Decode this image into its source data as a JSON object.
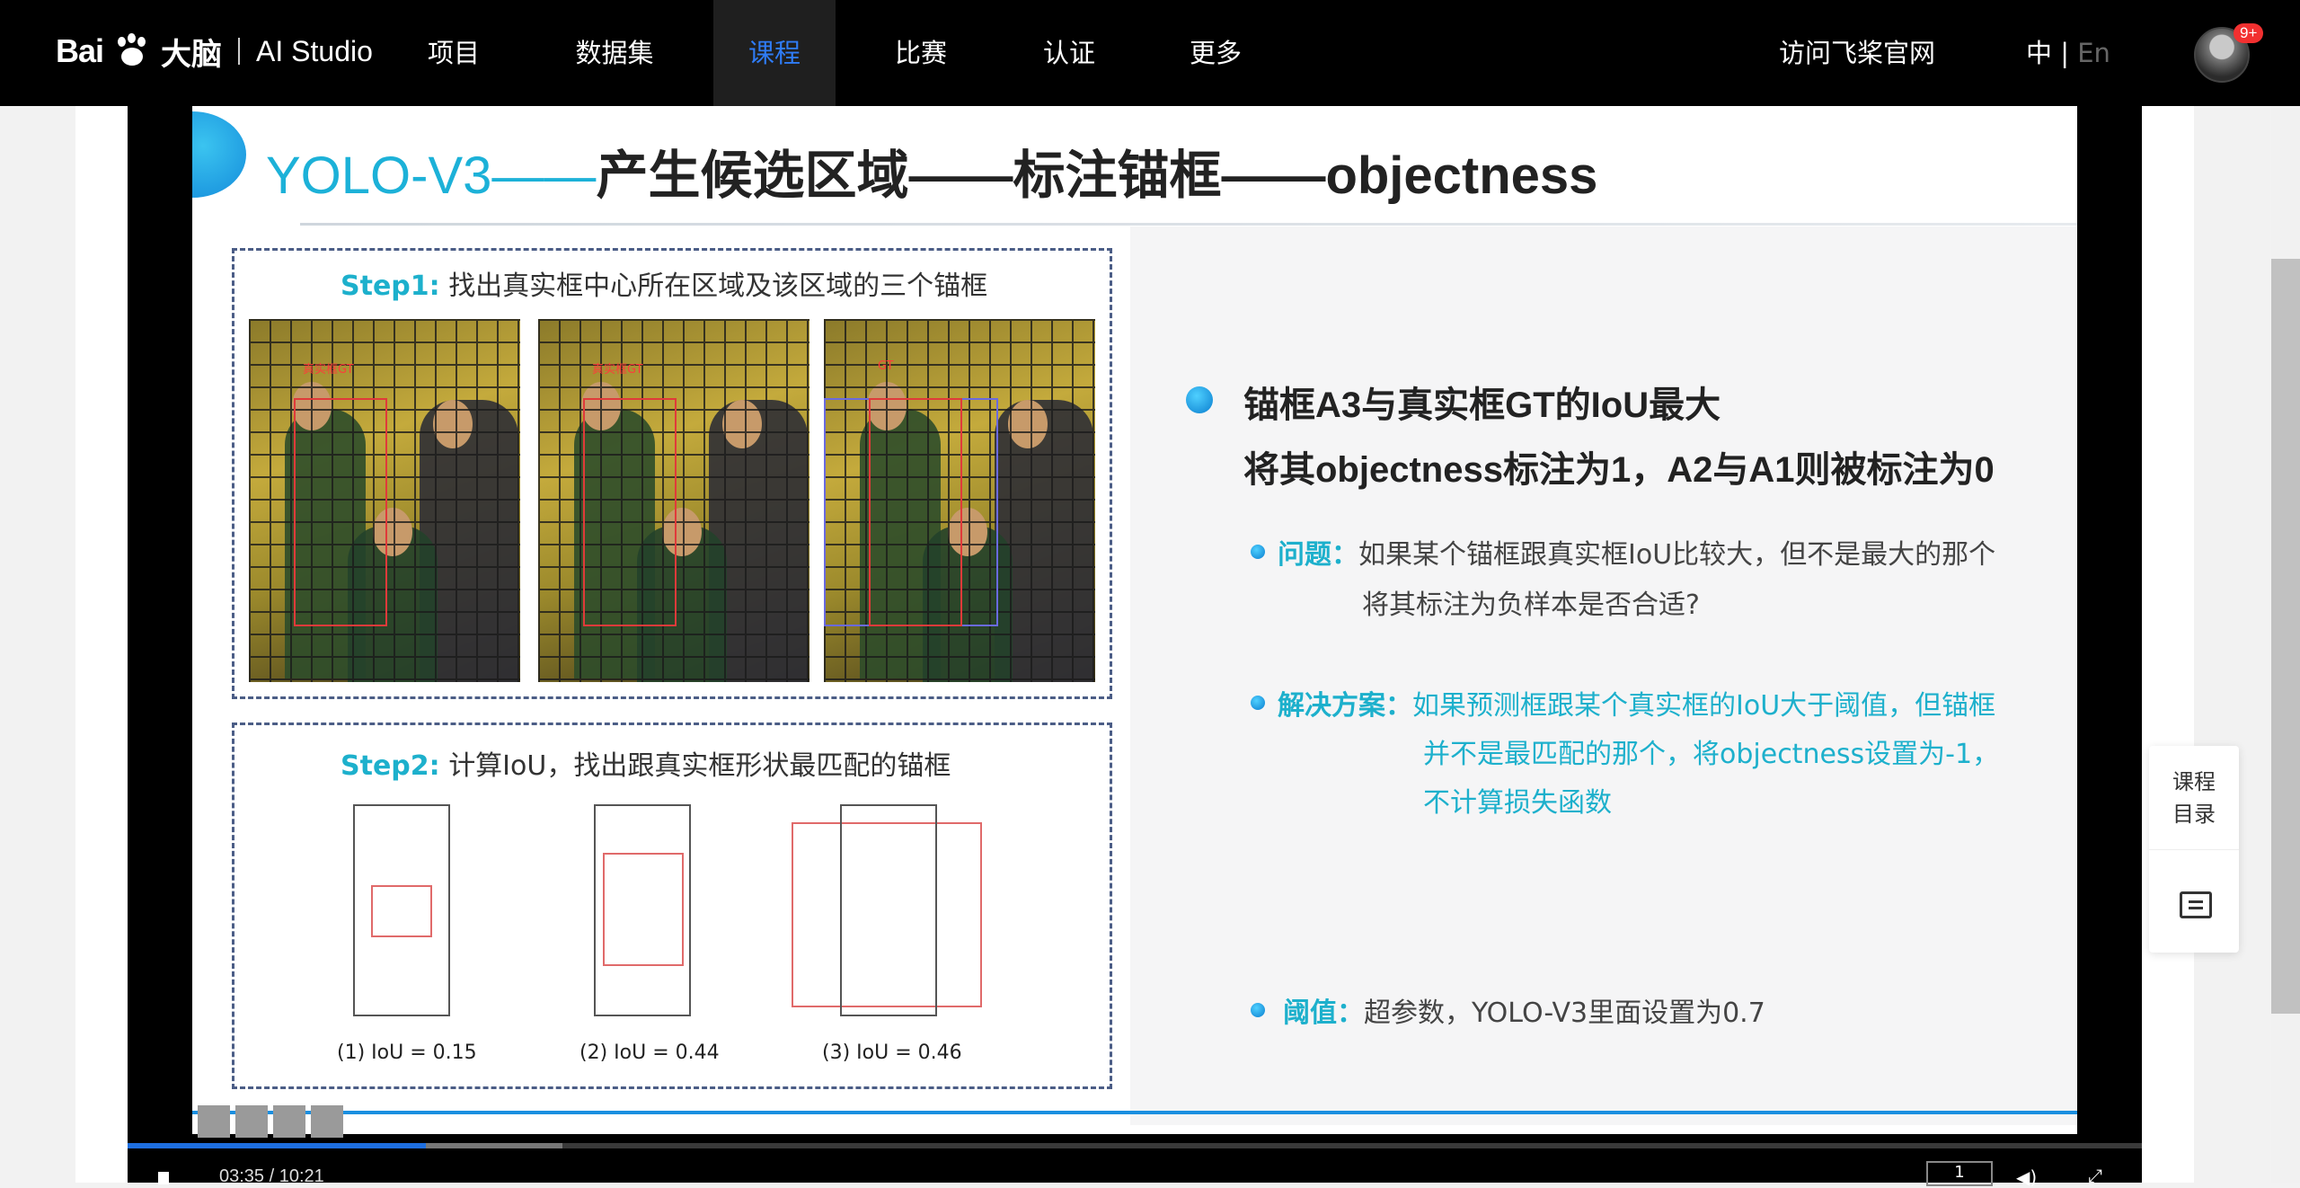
{
  "nav": {
    "logo_bai": "Bai",
    "logo_dunao": "大脑",
    "logo_studio": "AI Studio",
    "items": [
      "项目",
      "数据集",
      "课程",
      "比赛",
      "认证",
      "更多"
    ],
    "active": "课程",
    "external_link": "访问飞桨官网",
    "lang_cn": "中",
    "lang_sep": "|",
    "lang_en": "En",
    "badge": "9+"
  },
  "slide": {
    "title_blue": "YOLO-V3——",
    "title_dark": "产生候选区域——标注锚框——objectness",
    "step1_label": "Step1:",
    "step1_text": "找出真实框中心所在区域及该区域的三个锚框",
    "photo_labels": [
      "真实框GT",
      "真实框GT",
      "GT"
    ],
    "step2_label": "Step2:",
    "step2_text": "计算IoU，找出跟真实框形状最匹配的锚框",
    "captions": [
      "(1) IoU = 0.15",
      "(2) IoU = 0.44",
      "(3) IoU = 0.46"
    ],
    "main_line1": "锚框A3与真实框GT的IoU最大",
    "main_line2": "将其objectness标注为1，A2与A1则被标注为0",
    "q_key": "问题：",
    "q_line1": "如果某个锚框跟真实框IoU比较大，但不是最大的那个",
    "q_line2": "将其标注为负样本是否合适?",
    "s_key": "解决方案：",
    "s_line1": "如果预测框跟某个真实框的IoU大于阈值，但锚框",
    "s_line2": "并不是最匹配的那个，将objectness设置为-1，",
    "s_line3": "不计算损失函数",
    "t_key": "阈值：",
    "t_text": "超参数，YOLO-V3里面设置为0.7"
  },
  "player": {
    "time": "03:35 / 10:21",
    "rate": "1"
  },
  "side": {
    "catalog_l1": "课程",
    "catalog_l2": "目录"
  }
}
